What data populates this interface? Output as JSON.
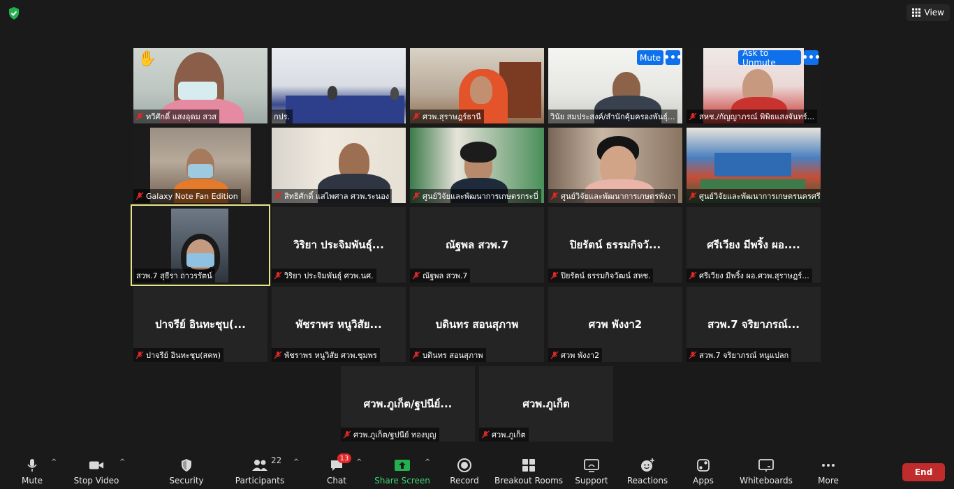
{
  "top": {
    "view_label": "View"
  },
  "tiles": [
    {
      "label": "ทวีศักดิ์  แสงอุดม สวส",
      "hand": "✋"
    },
    {
      "label": "กปร."
    },
    {
      "label": "ศวพ.สุราษฎร์ธานี"
    },
    {
      "label": "วินัย สมประสงค์/สำนักคุ้มครองพันธุ์...",
      "button": "Mute",
      "more": "•••"
    },
    {
      "label": "สหช./กัญญาภรณ์ พิพิธแสงจันทร์...",
      "button": "Ask to Unmute",
      "more": "•••"
    },
    {
      "label": "Galaxy Note Fan Edition"
    },
    {
      "label": "สิทธิศักดิ์ แสไพศาล ศวพ.ระนอง"
    },
    {
      "label": "ศูนย์วิจัยและพัฒนาการเกษตรกระบี่"
    },
    {
      "label": "ศูนย์วิจัยและพัฒนาการเกษตรพังงา"
    },
    {
      "label": "ศูนย์วิจัยและพัฒนาการเกษตรนครศรีธรรมราช"
    },
    {
      "label": "สวพ.7 สุธีรา ถาวรรัตน์"
    },
    {
      "center": "วิริยา ประจิมพันธุ์...",
      "label": "วิริยา ประจิมพันธุ์ ศวพ.นศ."
    },
    {
      "center": "ณัฐพล สวพ.7",
      "label": "ณัฐพล สวพ.7"
    },
    {
      "center": "ปิยรัตน์ ธรรมกิจวั...",
      "label": "ปิยรัตน์ ธรรมกิจวัฒน์ สหช."
    },
    {
      "center": "ศรีเวียง มีพริ้ง ผอ....",
      "label": "ศรีเวียง มีพริ้ง ผอ.ศวพ.สุราษฎร์..."
    },
    {
      "center": "ปาจรีย์ อินทะชุบ(...",
      "label": "ปาจรีย์ อินทะชุบ(สคพ)"
    },
    {
      "center": "พัชราพร หนูวิสัย...",
      "label": "พัชราพร หนูวิสัย ศวพ.ชุมพร"
    },
    {
      "center": "บดินทร สอนสุภาพ",
      "label": "บดินทร สอนสุภาพ"
    },
    {
      "center": "ศวพ พังงา2",
      "label": "ศวพ พังงา2"
    },
    {
      "center": "สวพ.7 จริยาภรณ์...",
      "label": "สวพ.7 จริยาภรณ์ หนูแปลก"
    },
    {
      "center": "ศวพ.ภูเก็ต/ฐปนีย์...",
      "label": "ศวพ.ภูเก็ต/ฐปนีย์ ทองบุญ"
    },
    {
      "center": "ศวพ.ภูเก็ต",
      "label": "ศวพ.ภูเก็ต"
    }
  ],
  "toolbar": {
    "mute": "Mute",
    "stop_video": "Stop Video",
    "security": "Security",
    "participants": "Participants",
    "participants_count": "22",
    "chat": "Chat",
    "chat_badge": "13",
    "share_screen": "Share Screen",
    "record": "Record",
    "breakout_rooms": "Breakout Rooms",
    "support": "Support",
    "reactions": "Reactions",
    "apps": "Apps",
    "whiteboards": "Whiteboards",
    "more": "More",
    "end": "End"
  },
  "colors": {
    "accent_blue": "#0e71eb",
    "share_green": "#3fd26d",
    "end_red": "#c02b2b",
    "active_speaker": "#e8e68a",
    "mic_off_red": "#e02828"
  }
}
